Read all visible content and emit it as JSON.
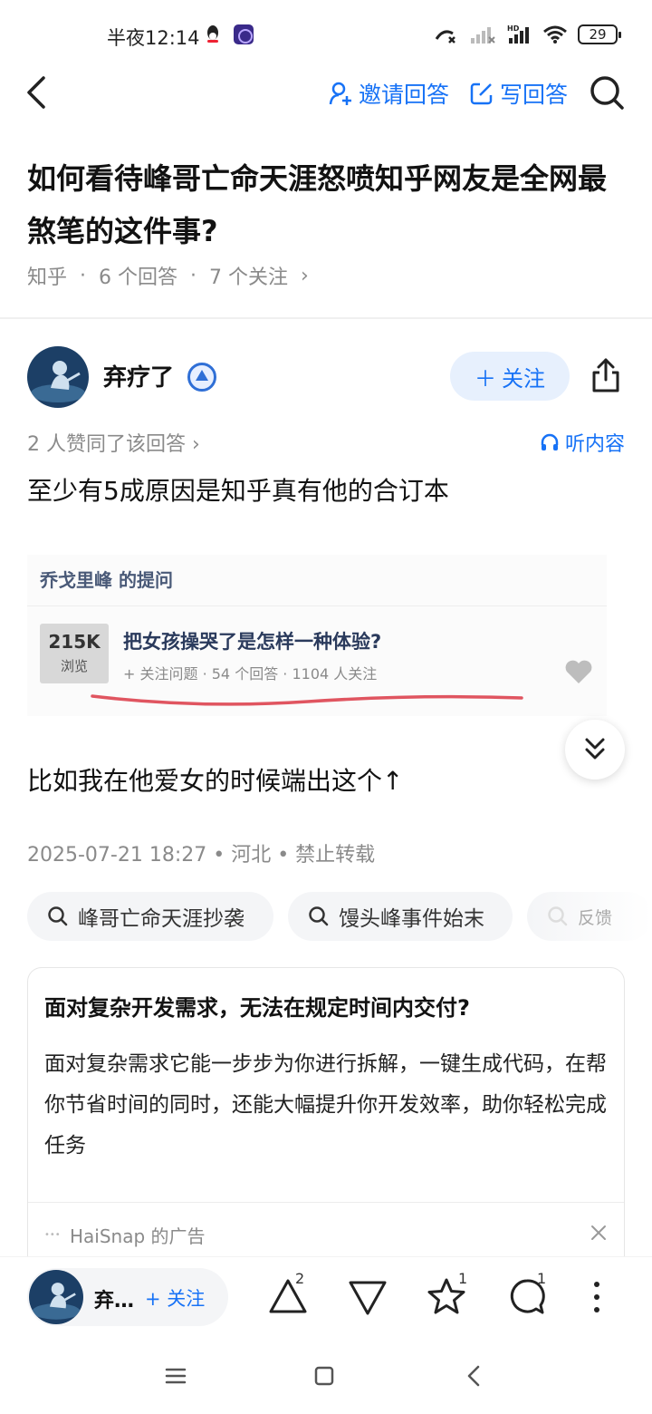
{
  "status_bar": {
    "time": "半夜12:14",
    "battery": "29",
    "network_label": "HD"
  },
  "top_nav": {
    "invite_label": "邀请回答",
    "write_label": "写回答"
  },
  "question": {
    "title": "如何看待峰哥亡命天涯怒喷知乎网友是全网最煞笔的这件事?",
    "source": "知乎",
    "answers": "6 个回答",
    "followers": "7 个关注"
  },
  "author": {
    "name": "弃疗了",
    "follow_label": "关注"
  },
  "answer": {
    "upvote_text": "2 人赞同了该回答",
    "listen_label": "听内容",
    "para1": "至少有5成原因是知乎真有他的合订本",
    "para2": "比如我在他爱女的时候端出这个↑",
    "meta": "2025-07-21 18:27 • 河北 • 禁止转载"
  },
  "embedded_image": {
    "asker": "乔戈里峰 的提问",
    "views_count": "215K",
    "views_label": "浏览",
    "question": "把女孩操哭了是怎样一种体验?",
    "meta": "+ 关注问题 · 54 个回答 · 1104 人关注"
  },
  "related_searches": [
    "峰哥亡命天涯抄袭",
    "馒头峰事件始末"
  ],
  "feedback_label": "反馈",
  "ad": {
    "title": "面对复杂开发需求，无法在规定时间内交付?",
    "body": "面对复杂需求它能一步步为你进行拆解，一键生成代码，在帮你节省时间的同时，还能大幅提升你开发效率，助你轻松完成任务",
    "source": "HaiSnap 的广告"
  },
  "bottom_bar": {
    "author_short": "弃…",
    "follow_label": "+ 关注",
    "upvote_count": "2",
    "favorite_count": "1",
    "comment_count": "1"
  },
  "colors": {
    "accent": "#1772f6",
    "text": "#121212",
    "muted": "#8a8a8a",
    "chip_bg": "#f4f5f7"
  }
}
